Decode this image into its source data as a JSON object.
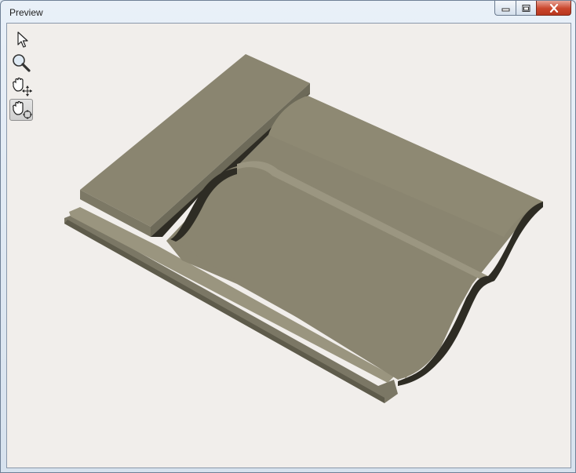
{
  "window": {
    "title": "Preview",
    "controls": {
      "minimize_icon": "minimize-icon",
      "maximize_icon": "maximize-icon",
      "close_icon": "close-icon"
    }
  },
  "toolbar": {
    "tools": [
      {
        "name": "select",
        "icon": "arrow-pointer-icon",
        "active": false
      },
      {
        "name": "zoom",
        "icon": "magnifier-icon",
        "active": false
      },
      {
        "name": "pan",
        "icon": "hand-pan-icon",
        "active": false
      },
      {
        "name": "rotate",
        "icon": "hand-rotate-icon",
        "active": true
      }
    ]
  },
  "colors": {
    "model_top": "#8a8570",
    "model_side_light": "#7f7a67",
    "model_side_dark": "#5b5848",
    "model_shadow": "#2e2c24",
    "background": "#f1eeeb"
  }
}
